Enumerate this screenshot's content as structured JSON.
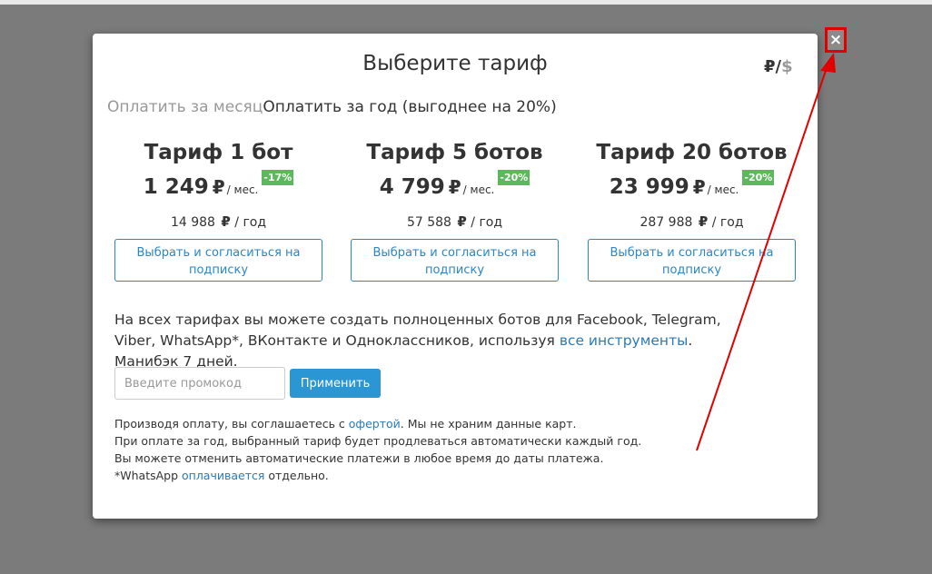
{
  "modal": {
    "title": "Выберите тариф",
    "currency": {
      "rub": "₽",
      "sep": "/",
      "usd": "$"
    },
    "period_tabs": {
      "month": "Оплатить за месяц",
      "year": "Оплатить за год (выгоднее на 20%)"
    },
    "plans": [
      {
        "name": "Тариф 1 бот",
        "price": "1 249",
        "currency": "₽",
        "unit": "/ мес.",
        "discount": "-17%",
        "year_price": "14 988",
        "year_unit": "/ год",
        "button": "Выбрать и согласиться на подписку"
      },
      {
        "name": "Тариф 5 ботов",
        "price": "4 799",
        "currency": "₽",
        "unit": "/ мес.",
        "discount": "-20%",
        "year_price": "57 588",
        "year_unit": "/ год",
        "button": "Выбрать и согласиться на подписку"
      },
      {
        "name": "Тариф 20 ботов",
        "price": "23 999",
        "currency": "₽",
        "unit": "/ мес.",
        "discount": "-20%",
        "year_price": "287 988",
        "year_unit": "/ год",
        "button": "Выбрать и согласиться на подписку"
      }
    ],
    "info": {
      "text_before": "На всех тарифах вы можете создать полноценных ботов для Facebook, Telegram, Viber, WhatsApp*, ВКонтакте и Одноклассников, используя ",
      "link": "все инструменты",
      "text_after": ". Манибэк 7 дней."
    },
    "promo": {
      "placeholder": "Введите промокод",
      "apply": "Применить"
    },
    "legal": {
      "line1_before": "Производя оплату, вы соглашаетесь с ",
      "line1_link": "офертой",
      "line1_after": ". Мы не храним данные карт.",
      "line2": "При оплате за год, выбранный тариф будет продлеваться автоматически каждый год.",
      "line3": "Вы можете отменить автоматические платежи в любое время до даты платежа.",
      "line4_before": "*WhatsApp ",
      "line4_link": "оплачивается",
      "line4_after": " отдельно."
    }
  },
  "close": {
    "icon": "×"
  },
  "colors": {
    "accent": "#2b86c5",
    "discount": "#5cb85c",
    "annotation": "#e00000",
    "overlay": "#7b7b7b"
  }
}
